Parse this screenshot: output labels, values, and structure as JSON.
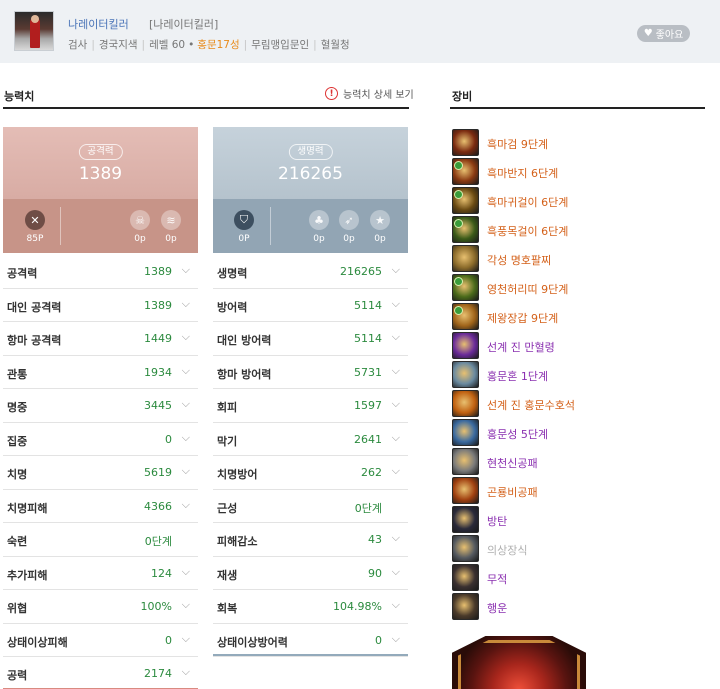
{
  "header": {
    "name": "나레이터킬러",
    "server": "[나레이터킬러]",
    "class": "검사",
    "region": "경국지색",
    "level": "레벨 60",
    "hongmun": "홍문17성",
    "faction": "무림맹입문인",
    "clan": "혈월청",
    "like_label": "좋아요"
  },
  "stats_section": {
    "title": "능력치",
    "detail_link": "능력치 상세 보기"
  },
  "equip_section": {
    "title": "장비"
  },
  "attack_card": {
    "label": "공격력",
    "value": "1389",
    "points": [
      "85P",
      "0p",
      "0p"
    ]
  },
  "life_card": {
    "label": "생명력",
    "value": "216265",
    "points": [
      "0P",
      "0p",
      "0p",
      "0p"
    ]
  },
  "left_stats": [
    {
      "name": "공격력",
      "value": "1389",
      "chev": true
    },
    {
      "name": "대인 공격력",
      "value": "1389",
      "chev": true
    },
    {
      "name": "항마 공격력",
      "value": "1449",
      "chev": true
    },
    {
      "name": "관통",
      "value": "1934",
      "chev": true
    },
    {
      "name": "명중",
      "value": "3445",
      "chev": true
    },
    {
      "name": "집중",
      "value": "0",
      "chev": true
    },
    {
      "name": "치명",
      "value": "5619",
      "chev": true
    },
    {
      "name": "치명피해",
      "value": "4366",
      "chev": true
    },
    {
      "name": "숙련",
      "value": "0단계",
      "chev": false
    },
    {
      "name": "추가피해",
      "value": "124",
      "chev": true
    },
    {
      "name": "위협",
      "value": "100%",
      "chev": true
    },
    {
      "name": "상태이상피해",
      "value": "0",
      "chev": true
    },
    {
      "name": "공력",
      "value": "2174",
      "chev": true
    }
  ],
  "right_stats": [
    {
      "name": "생명력",
      "value": "216265",
      "chev": true
    },
    {
      "name": "방어력",
      "value": "5114",
      "chev": true
    },
    {
      "name": "대인 방어력",
      "value": "5114",
      "chev": true
    },
    {
      "name": "항마 방어력",
      "value": "5731",
      "chev": true
    },
    {
      "name": "회피",
      "value": "1597",
      "chev": true
    },
    {
      "name": "막기",
      "value": "2641",
      "chev": true
    },
    {
      "name": "치명방어",
      "value": "262",
      "chev": true
    },
    {
      "name": "근성",
      "value": "0단계",
      "chev": false
    },
    {
      "name": "피해감소",
      "value": "43",
      "chev": true
    },
    {
      "name": "재생",
      "value": "90",
      "chev": true
    },
    {
      "name": "회복",
      "value": "104.98%",
      "chev": true
    },
    {
      "name": "상태이상방어력",
      "value": "0",
      "chev": true
    }
  ],
  "equipment": [
    {
      "name": "흑마검 9단계",
      "color": "#d4611a",
      "icon": "#7a2a10",
      "badge": false
    },
    {
      "name": "흑마반지 6단계",
      "color": "#d4611a",
      "icon": "#8a3a12",
      "badge": true
    },
    {
      "name": "흑마귀걸이 6단계",
      "color": "#d4611a",
      "icon": "#6a4a12",
      "badge": true
    },
    {
      "name": "흑풍목걸이 6단계",
      "color": "#d4611a",
      "icon": "#3a5a18",
      "badge": true
    },
    {
      "name": "각성 명호팔찌",
      "color": "#d4611a",
      "icon": "#8a6a2a",
      "badge": false
    },
    {
      "name": "영천허리띠 9단계",
      "color": "#d4611a",
      "icon": "#4a6a1a",
      "badge": true
    },
    {
      "name": "제왕장갑 9단계",
      "color": "#d4611a",
      "icon": "#a0641a",
      "badge": true
    },
    {
      "name": "선계 진 만혈령",
      "color": "#8a2fb0",
      "icon": "#6a2a9a",
      "badge": false
    },
    {
      "name": "홍문혼 1단계",
      "color": "#8a2fb0",
      "icon": "#6a8aa0",
      "badge": false
    },
    {
      "name": "선계 진 홍문수호석",
      "color": "#d4611a",
      "icon": "#c06010",
      "badge": false
    },
    {
      "name": "홍문성 5단계",
      "color": "#8a2fb0",
      "icon": "#3a6aa0",
      "badge": false
    },
    {
      "name": "현천신공패",
      "color": "#8a2fb0",
      "icon": "#7a7a7a",
      "badge": false
    },
    {
      "name": "곤룡비공패",
      "color": "#d4611a",
      "icon": "#a04010",
      "badge": false
    },
    {
      "name": "방탄",
      "color": "#8a2fb0",
      "icon": "#2a2a3a",
      "badge": false
    },
    {
      "name": "의상장식",
      "color": "#b0b0b0",
      "icon": "#555a60",
      "badge": false
    },
    {
      "name": "무적",
      "color": "#8a2fb0",
      "icon": "#3a3030",
      "badge": false
    },
    {
      "name": "행운",
      "color": "#8a2fb0",
      "icon": "#4a3a2a",
      "badge": false
    }
  ]
}
